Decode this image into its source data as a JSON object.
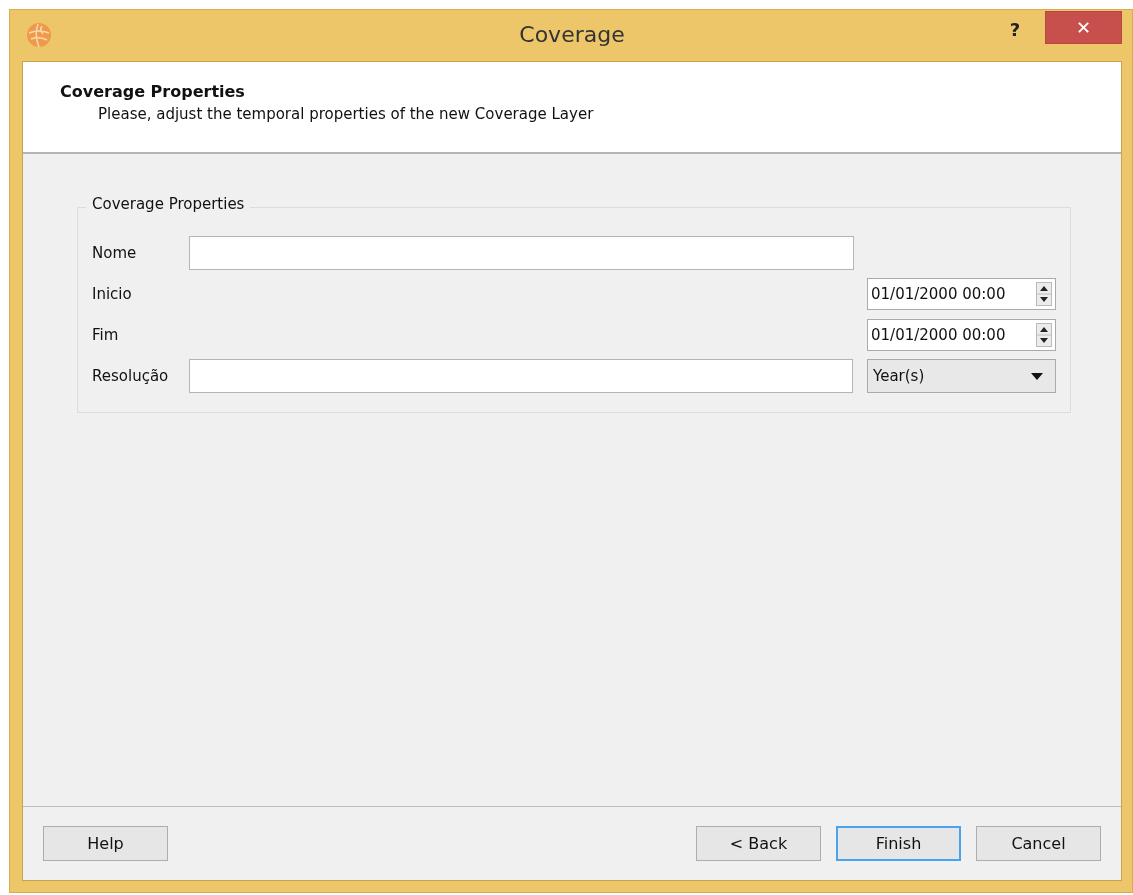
{
  "window": {
    "title": "Coverage",
    "help_glyph": "?",
    "close_glyph": "✕"
  },
  "header": {
    "title": "Coverage Properties",
    "subtitle": "Please, adjust the temporal properties of the new Coverage Layer"
  },
  "group": {
    "title": "Coverage Properties",
    "fields": [
      {
        "kind": "text",
        "label": "Nome"
      },
      {
        "kind": "datetime",
        "label": "Inicio",
        "value": "01/01/2000 00:00"
      },
      {
        "kind": "datetime",
        "label": "Fim",
        "value": "01/01/2000 00:00"
      },
      {
        "kind": "text_combo",
        "label": "Resolução",
        "option": "Year(s)"
      }
    ]
  },
  "buttons": {
    "left": [
      {
        "label": "Help",
        "focused": false
      }
    ],
    "right": [
      {
        "label": "< Back",
        "focused": false
      },
      {
        "label": "Finish",
        "focused": true
      },
      {
        "label": "Cancel",
        "focused": false
      }
    ]
  }
}
